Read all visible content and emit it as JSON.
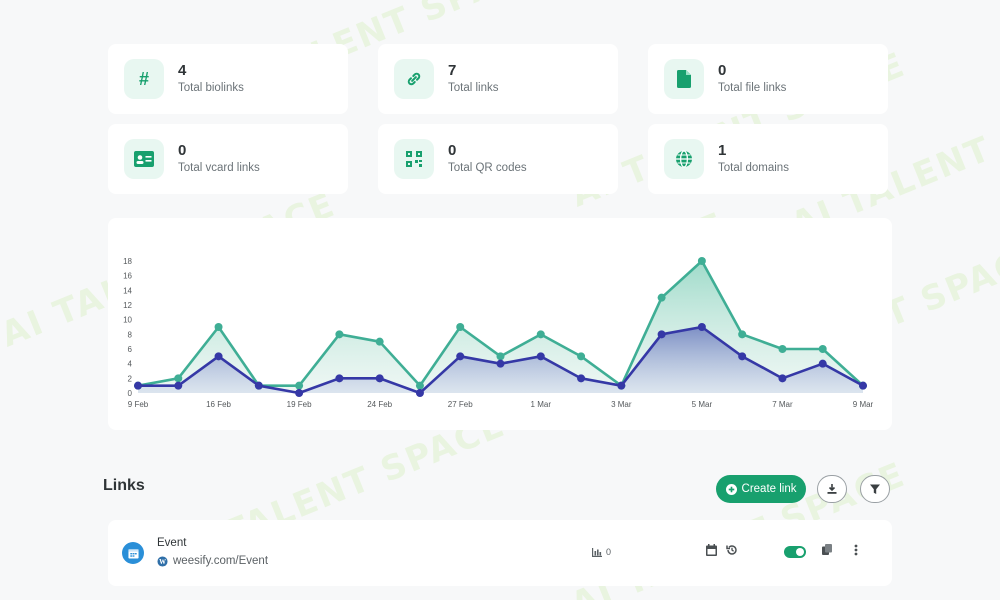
{
  "stats": [
    {
      "value": "4",
      "label": "Total biolinks",
      "icon": "hash-icon"
    },
    {
      "value": "7",
      "label": "Total links",
      "icon": "link-icon"
    },
    {
      "value": "0",
      "label": "Total file links",
      "icon": "file-icon"
    },
    {
      "value": "0",
      "label": "Total vcard links",
      "icon": "vcard-icon"
    },
    {
      "value": "0",
      "label": "Total QR codes",
      "icon": "qr-icon"
    },
    {
      "value": "1",
      "label": "Total domains",
      "icon": "globe-icon"
    }
  ],
  "chart_data": {
    "type": "area",
    "x_ticks": [
      "9 Feb",
      "16 Feb",
      "19 Feb",
      "24 Feb",
      "27 Feb",
      "1 Mar",
      "3 Mar",
      "5 Mar",
      "7 Mar",
      "9 Mar"
    ],
    "x_tick_positions": [
      0,
      2,
      4,
      6,
      8,
      10,
      12,
      14,
      16,
      18
    ],
    "y_ticks": [
      0,
      2,
      4,
      6,
      8,
      10,
      12,
      14,
      16,
      18
    ],
    "ylim": [
      0,
      18
    ],
    "x_count": 19,
    "series": [
      {
        "values": [
          1,
          2,
          9,
          1,
          1,
          8,
          7,
          1,
          9,
          5,
          8,
          5,
          1,
          13,
          18,
          8,
          6,
          6,
          1
        ],
        "color": "#3fae95"
      },
      {
        "values": [
          1,
          1,
          5,
          1,
          0,
          2,
          2,
          0,
          5,
          4,
          5,
          2,
          1,
          8,
          9,
          5,
          2,
          4,
          1
        ],
        "color": "#3538a6"
      }
    ]
  },
  "links_section": {
    "title": "Links",
    "create_label": "Create link"
  },
  "link_row": {
    "name": "Event",
    "url": "weesify.com/Event",
    "clicks": "0"
  },
  "watermark": "AI TALENT SPACE",
  "colors": {
    "accent": "#18a06e",
    "icon_bg": "#e8f7f1"
  }
}
